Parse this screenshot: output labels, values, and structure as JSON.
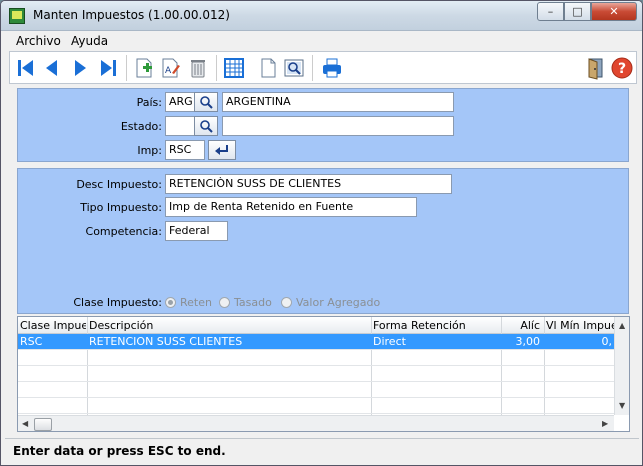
{
  "window": {
    "title": "Manten Impuestos (1.00.00.012)",
    "min_glyph": "–",
    "max_glyph": "□",
    "close_glyph": "✕"
  },
  "menu": {
    "items": [
      "Archivo",
      "Ayuda"
    ]
  },
  "toolbar": {
    "icons": [
      "first-record-icon",
      "previous-record-icon",
      "next-record-icon",
      "last-record-icon",
      "add-record-icon",
      "edit-record-icon",
      "delete-record-icon",
      "grid-view-icon",
      "document-icon",
      "preview-icon",
      "print-icon",
      "exit-door-icon",
      "help-icon"
    ],
    "help_glyph": "?"
  },
  "filters": {
    "pais_label": "País:",
    "pais_code": "ARG",
    "pais_name": "ARGENTINA",
    "estado_label": "Estado:",
    "estado_code": "",
    "estado_name": "",
    "imp_label": "Imp:",
    "imp_value": "RSC"
  },
  "detail": {
    "desc_label": "Desc Impuesto:",
    "desc_value": "RETENCIÒN SUSS DE CLIENTES",
    "tipo_label": "Tipo Impuesto:",
    "tipo_value": "Imp de Renta Retenido en Fuente",
    "competencia_label": "Competencia:",
    "competencia_value": "Federal",
    "clase_label": "Clase Impuesto:",
    "clase_options": [
      "Reten",
      "Tasado",
      "Valor Agregado"
    ],
    "clase_selected": "Reten"
  },
  "grid": {
    "columns": [
      "Clase Impuesto",
      "Descripción",
      "Forma Retención",
      "Alíc",
      "Vl Mín Impuesto"
    ],
    "rows": [
      {
        "clase": "RSC",
        "descripcion": "RETENCION SUSS CLIENTES",
        "forma": "Direct",
        "alic": "3,00",
        "vlmin": "0,"
      }
    ]
  },
  "status": {
    "message": "Enter data or press ESC to end."
  },
  "colors": {
    "panel": "#a4c6f8",
    "selected_row": "#3399ff",
    "accent": "#1a6fd6"
  }
}
